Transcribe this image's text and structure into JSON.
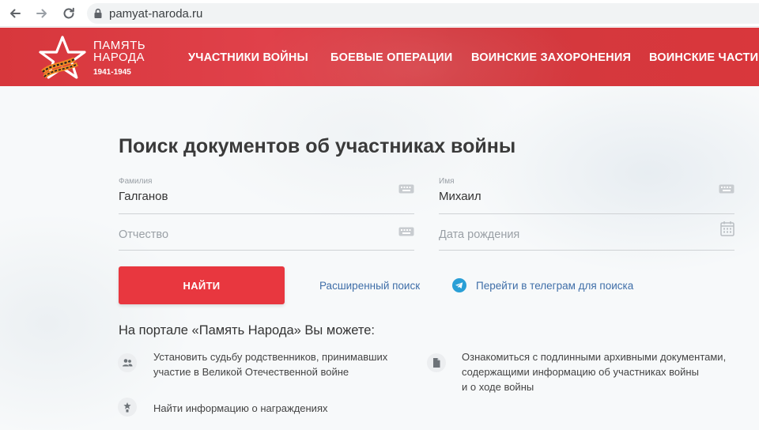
{
  "browser": {
    "url": "pamyat-naroda.ru"
  },
  "header": {
    "logo": {
      "line1": "ПАМЯТЬ",
      "line2": "НАРОДА",
      "years": "1941-1945"
    },
    "menu": [
      {
        "label": "УЧАСТНИКИ ВОЙНЫ"
      },
      {
        "label": "БОЕВЫЕ ОПЕРАЦИИ"
      },
      {
        "label": "ВОИНСКИЕ ЗАХОРОНЕНИЯ"
      },
      {
        "label": "ВОИНСКИЕ ЧАСТИ"
      }
    ]
  },
  "search": {
    "title": "Поиск документов об участниках войны",
    "surname": {
      "label": "Фамилия",
      "value": "Галганов"
    },
    "name": {
      "label": "Имя",
      "value": "Михаил"
    },
    "patronymic": {
      "placeholder": "Отчество"
    },
    "birthdate": {
      "placeholder": "Дата рождения"
    },
    "submit_label": "НАЙТИ",
    "advanced_link": "Расширенный поиск",
    "telegram_link": "Перейти в телеграм для поиска"
  },
  "features": {
    "heading": "На портале «Память Народа» Вы можете:",
    "items": [
      {
        "icon": "people-icon",
        "line1": "Установить судьбу родственников, принимавших",
        "line2": "участие в Великой Отечественной войне"
      },
      {
        "icon": "document-icon",
        "line1": "Ознакомиться с подлинными архивными документами,",
        "line2": "содержащими информацию об участниках войны",
        "line3": "и о ходе войны"
      },
      {
        "icon": "medal-icon",
        "line1": "Найти информацию о награждениях"
      }
    ]
  },
  "colors": {
    "brand_red": "#e8373f",
    "link_blue": "#3f6ea8"
  }
}
